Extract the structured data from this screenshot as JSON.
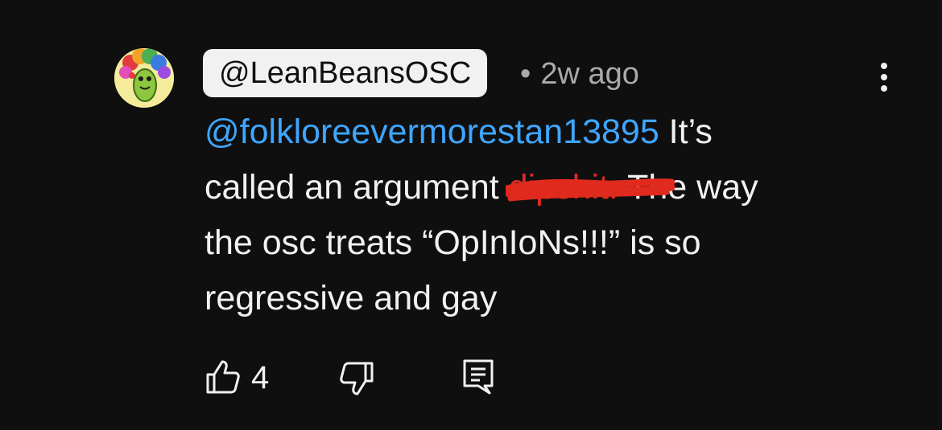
{
  "comment": {
    "author": "@LeanBeansOSC",
    "separator": "•",
    "timestamp": "2w ago",
    "mention": "@folkloreevermorestan13895",
    "text_before_censor": " It’s\ncalled an argument ",
    "censored_word": "dipshit.",
    "text_after_censor": " The way\nthe osc treats “OpInIoNs!!!” is so\nregressive and gay",
    "like_count": "4"
  },
  "icons": {
    "more": "more-vertical-icon",
    "like": "thumbs-up-icon",
    "dislike": "thumbs-down-icon",
    "reply": "reply-comment-icon"
  },
  "colors": {
    "background": "#0f0f0f",
    "text": "#f1f1f1",
    "mention": "#3ea6ff",
    "meta": "#aaaaaa",
    "censor": "#e02a1e"
  }
}
